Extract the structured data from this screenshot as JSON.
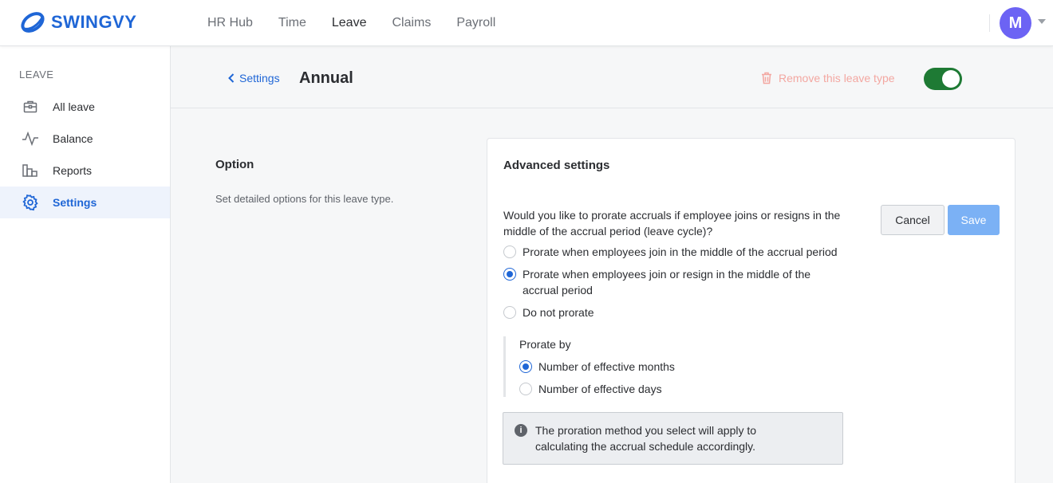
{
  "brand": {
    "name": "SWINGVY",
    "color": "#1f66d6"
  },
  "nav": {
    "items": [
      {
        "label": "HR Hub",
        "active": false
      },
      {
        "label": "Time",
        "active": false
      },
      {
        "label": "Leave",
        "active": true
      },
      {
        "label": "Claims",
        "active": false
      },
      {
        "label": "Payroll",
        "active": false
      }
    ]
  },
  "user": {
    "initial": "M",
    "avatar_color": "#6c63f4"
  },
  "sidebar": {
    "heading": "LEAVE",
    "items": [
      {
        "label": "All leave",
        "icon": "briefcase-icon",
        "active": false
      },
      {
        "label": "Balance",
        "icon": "activity-icon",
        "active": false
      },
      {
        "label": "Reports",
        "icon": "bar-chart-icon",
        "active": false
      },
      {
        "label": "Settings",
        "icon": "gear-icon",
        "active": true
      }
    ]
  },
  "header": {
    "back_label": "Settings",
    "title": "Annual",
    "remove_label": "Remove this leave type",
    "toggle_on": true,
    "toggle_color": "#1e7a34"
  },
  "option": {
    "title": "Option",
    "description": "Set detailed options for this leave type."
  },
  "advanced": {
    "title": "Advanced settings",
    "question": "Would you like to prorate accruals if employee joins or resigns in the middle of the accrual period (leave cycle)?",
    "options": [
      {
        "label": "Prorate when employees join in the middle of the accrual period",
        "checked": false
      },
      {
        "label": "Prorate when employees join or resign in the middle of the accrual period",
        "checked": true
      },
      {
        "label": "Do not prorate",
        "checked": false
      }
    ],
    "prorate_by": {
      "title": "Prorate by",
      "options": [
        {
          "label": "Number of effective months",
          "checked": true
        },
        {
          "label": "Number of effective days",
          "checked": false
        }
      ]
    },
    "info": "The proration method you select will apply to calculating the accrual schedule accordingly.",
    "cancel_label": "Cancel",
    "save_label": "Save"
  }
}
